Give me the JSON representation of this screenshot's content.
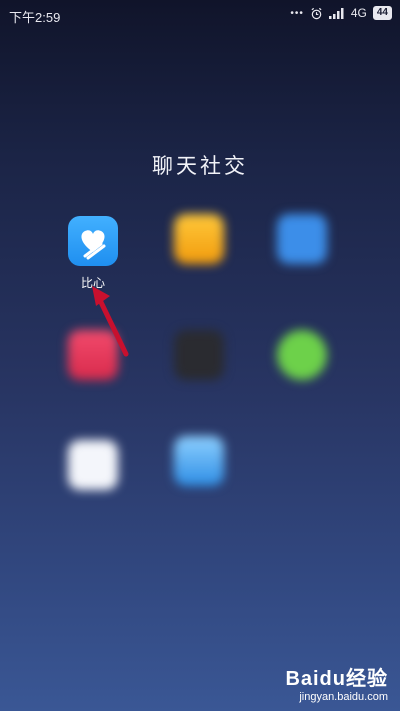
{
  "status_bar": {
    "time": "下午2:59",
    "network": "4G",
    "battery": "44"
  },
  "folder": {
    "title": "聊天社交"
  },
  "apps": [
    {
      "label": "比心",
      "icon": "heart-app-icon",
      "color": "#2a9bf7"
    },
    {
      "label": "",
      "icon": "yellow-app-icon",
      "color": "#f5a91f"
    },
    {
      "label": "",
      "icon": "blue-app-icon",
      "color": "#3c8ee9"
    },
    {
      "label": "",
      "icon": "pink-app-icon",
      "color": "#e23a5c"
    },
    {
      "label": "",
      "icon": "dark-app-icon",
      "color": "#2a2b30"
    },
    {
      "label": "",
      "icon": "wechat-icon",
      "color": "#6dd14a"
    },
    {
      "label": "",
      "icon": "white-app-icon",
      "color": "#f4f6fb"
    },
    {
      "label": "",
      "icon": "light-blue-app-icon",
      "color": "#4aa6f0"
    }
  ],
  "annotation": {
    "arrow_color": "#c8102e"
  },
  "watermark": {
    "logo": "Baidu经验",
    "url": "jingyan.baidu.com"
  }
}
